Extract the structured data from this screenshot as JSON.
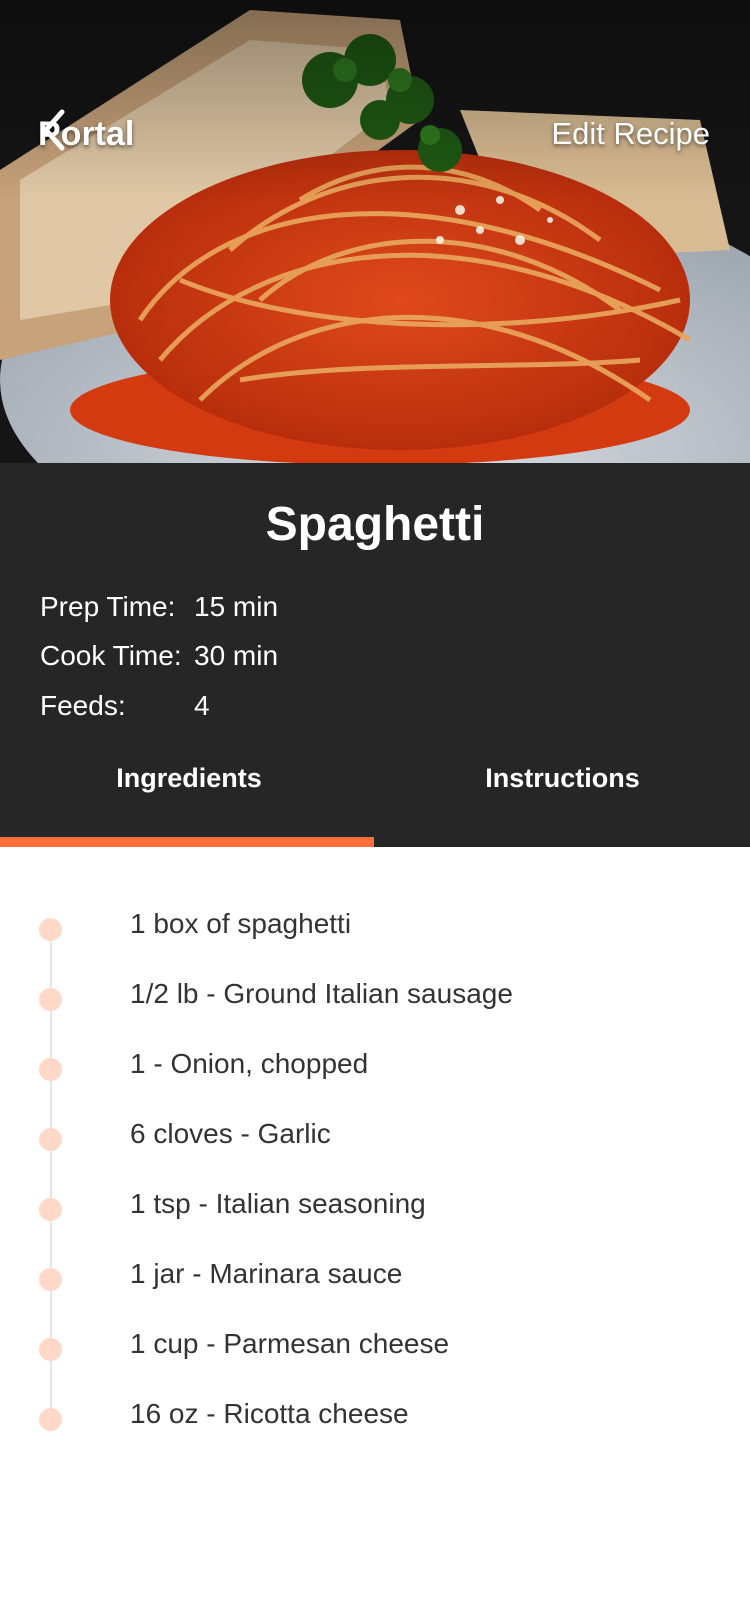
{
  "header": {
    "back_label": "Portal",
    "edit_label": "Edit Recipe"
  },
  "recipe": {
    "title": "Spaghetti",
    "meta": [
      {
        "label": "Prep Time:",
        "value": "15 min"
      },
      {
        "label": "Cook Time:",
        "value": "30 min"
      },
      {
        "label": "Feeds:",
        "value": "4"
      }
    ]
  },
  "tabs": [
    {
      "label": "Ingredients",
      "active": true
    },
    {
      "label": "Instructions",
      "active": false
    }
  ],
  "ingredients": [
    "1 box of spaghetti",
    "1/2 lb - Ground Italian sausage",
    "1 - Onion, chopped",
    "6 cloves - Garlic",
    "1 tsp - Italian seasoning",
    "1 jar - Marinara sauce",
    "1 cup - Parmesan cheese",
    "16 oz - Ricotta cheese"
  ],
  "colors": {
    "accent": "#ff6f3c",
    "panel": "#262626",
    "bullet": "#ffd8c8"
  },
  "icons": {
    "back": "chevron-left-icon",
    "bullet": "bullet-dot-icon"
  }
}
